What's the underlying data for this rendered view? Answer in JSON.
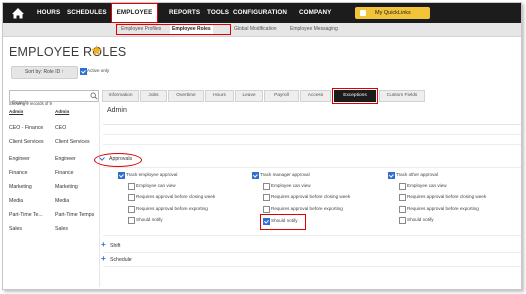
{
  "topnav": {
    "items": [
      "HOURS",
      "SCHEDULES",
      "EMPLOYEE",
      "REPORTS",
      "TOOLS",
      "CONFIGURATION",
      "COMPANY"
    ],
    "quicklinks": "My QuickLinks"
  },
  "subnav": {
    "items": [
      "Employee Profiles",
      "Employee Roles",
      "Global Modification",
      "Employee Messaging"
    ]
  },
  "page": {
    "title": "EMPLOYEE ROLES"
  },
  "toolbar": {
    "sort_label": "Sort by: Role ID ↑",
    "active_only_label": "Active only"
  },
  "search": {
    "placeholder": "Search"
  },
  "tabs": [
    "Information",
    "Jobs",
    "Overtime",
    "Hours",
    "Leave",
    "Payroll",
    "Access",
    "Exceptions",
    "Custom Fields"
  ],
  "list": {
    "showing": "Showing 9 records of 9",
    "col1": "Admin",
    "col2": "Admin",
    "rows": [
      [
        "CEO - Finance",
        "CEO"
      ],
      [
        "Client Services",
        "Client Services"
      ],
      [
        "Engineer",
        "Engineer"
      ],
      [
        "Finance",
        "Finance"
      ],
      [
        "Marketing",
        "Marketing"
      ],
      [
        "Media",
        "Media"
      ],
      [
        "Part-Time Te...",
        "Part-Time Temps"
      ],
      [
        "Sales",
        "Sales"
      ]
    ]
  },
  "content": {
    "title": "Admin",
    "approvals_label": "Approvals",
    "shift_label": "Shift",
    "schedule_label": "Schedule",
    "columns": [
      {
        "header": "Track employee approval",
        "items": [
          "Employee can view",
          "Requires approval before closing week",
          "Requires approval before exporting",
          "Should notify"
        ]
      },
      {
        "header": "Track manager approval",
        "items": [
          "Employee can view",
          "Requires approval before closing week",
          "Requires approval before exporting",
          "Should notify"
        ]
      },
      {
        "header": "Track other approval",
        "items": [
          "Employee can view",
          "Requires approval before closing week",
          "Requires approval before exporting",
          "Should notify"
        ]
      }
    ]
  },
  "colors": {
    "accent": "#2f6fd1",
    "highlight": "#e00000",
    "nav": "#1c1c1c",
    "quicklinks": "#f2c43a",
    "star": "#f2b01e"
  }
}
